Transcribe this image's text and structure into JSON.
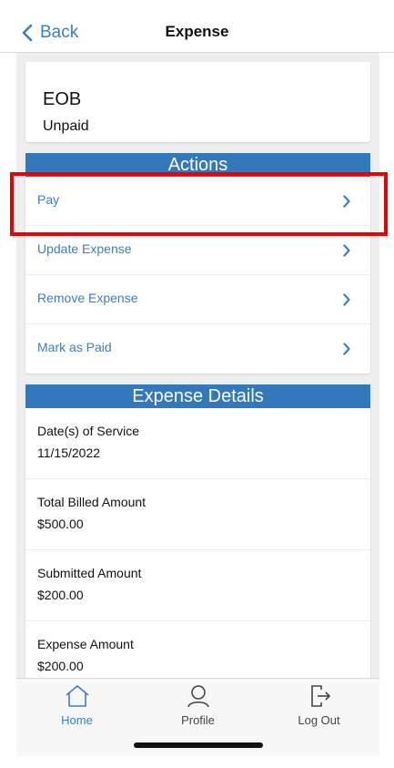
{
  "nav": {
    "back_label": "Back",
    "title": "Expense"
  },
  "eob": {
    "title": "EOB",
    "status": "Unpaid"
  },
  "actions": {
    "header": "Actions",
    "items": [
      {
        "label": "Pay"
      },
      {
        "label": "Update Expense"
      },
      {
        "label": "Remove Expense"
      },
      {
        "label": "Mark as Paid"
      }
    ]
  },
  "details": {
    "header": "Expense Details",
    "rows": [
      {
        "label": "Date(s) of Service",
        "value": "11/15/2022"
      },
      {
        "label": "Total Billed Amount",
        "value": "$500.00"
      },
      {
        "label": "Submitted Amount",
        "value": "$200.00"
      },
      {
        "label": "Expense Amount",
        "value": "$200.00"
      }
    ]
  },
  "tabbar": {
    "items": [
      {
        "label": "Home",
        "icon": "home-icon",
        "active": true
      },
      {
        "label": "Profile",
        "icon": "profile-icon",
        "active": false
      },
      {
        "label": "Log Out",
        "icon": "logout-icon",
        "active": false
      }
    ]
  },
  "colors": {
    "accent": "#3a7fc2",
    "header_bg": "#3378bb",
    "highlight": "#ee0000"
  }
}
